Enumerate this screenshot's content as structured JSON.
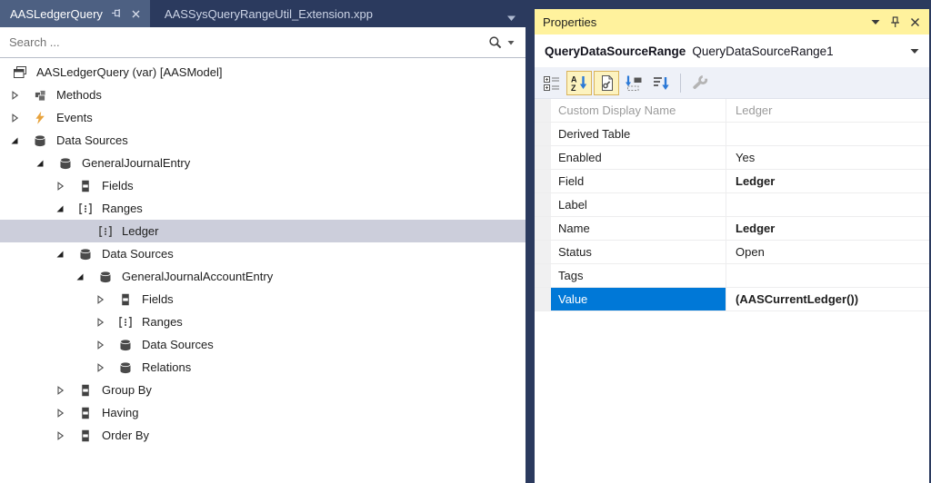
{
  "tabs": {
    "active_label": "AASLedgerQuery",
    "inactive_label": "AASSysQueryRangeUtil_Extension.xpp"
  },
  "search": {
    "placeholder": "Search ..."
  },
  "tree": {
    "items": [
      {
        "label": "AASLedgerQuery (var) [AASModel]",
        "level": 0,
        "expander": "none",
        "icon": "query",
        "selected": false
      },
      {
        "label": "Methods",
        "level": 1,
        "expander": "collapsed",
        "icon": "methods",
        "selected": false
      },
      {
        "label": "Events",
        "level": 1,
        "expander": "collapsed",
        "icon": "events",
        "selected": false
      },
      {
        "label": "Data Sources",
        "level": 1,
        "expander": "expanded",
        "icon": "database",
        "selected": false
      },
      {
        "label": "GeneralJournalEntry",
        "level": 2,
        "expander": "expanded",
        "icon": "database",
        "selected": false
      },
      {
        "label": "Fields",
        "level": 3,
        "expander": "collapsed",
        "icon": "fields",
        "selected": false
      },
      {
        "label": "Ranges",
        "level": 3,
        "expander": "expanded",
        "icon": "ranges",
        "selected": false
      },
      {
        "label": "Ledger",
        "level": 4,
        "expander": "none",
        "icon": "ranges",
        "selected": true
      },
      {
        "label": "Data Sources",
        "level": 3,
        "expander": "expanded",
        "icon": "database",
        "selected": false
      },
      {
        "label": "GeneralJournalAccountEntry",
        "level": 4,
        "expander": "expanded",
        "icon": "database",
        "selected": false
      },
      {
        "label": "Fields",
        "level": 5,
        "expander": "collapsed",
        "icon": "fields",
        "selected": false
      },
      {
        "label": "Ranges",
        "level": 5,
        "expander": "collapsed",
        "icon": "ranges",
        "selected": false
      },
      {
        "label": "Data Sources",
        "level": 5,
        "expander": "collapsed",
        "icon": "database",
        "selected": false
      },
      {
        "label": "Relations",
        "level": 5,
        "expander": "collapsed",
        "icon": "database",
        "selected": false
      },
      {
        "label": "Group By",
        "level": 3,
        "expander": "collapsed",
        "icon": "fields",
        "selected": false
      },
      {
        "label": "Having",
        "level": 3,
        "expander": "collapsed",
        "icon": "fields",
        "selected": false
      },
      {
        "label": "Order By",
        "level": 3,
        "expander": "collapsed",
        "icon": "fields",
        "selected": false
      }
    ]
  },
  "properties": {
    "title": "Properties",
    "object_type": "QueryDataSourceRange",
    "object_instance": "QueryDataSourceRange1",
    "toolbar": [
      {
        "name": "categorized",
        "selected": false,
        "disabled": false
      },
      {
        "name": "alphabetical",
        "selected": true,
        "disabled": false
      },
      {
        "name": "property-pages",
        "selected": true,
        "disabled": false
      },
      {
        "name": "set-value",
        "selected": false,
        "disabled": false
      },
      {
        "name": "sort-descending",
        "selected": false,
        "disabled": false
      },
      {
        "name": "separator"
      },
      {
        "name": "advanced-wrench",
        "selected": false,
        "disabled": true
      }
    ],
    "rows": [
      {
        "label": "Custom Display Name",
        "value": "Ledger",
        "disabled": true,
        "value_bold": false,
        "selected": false
      },
      {
        "label": "Derived Table",
        "value": "",
        "disabled": false,
        "value_bold": false,
        "selected": false
      },
      {
        "label": "Enabled",
        "value": "Yes",
        "disabled": false,
        "value_bold": false,
        "selected": false
      },
      {
        "label": "Field",
        "value": "Ledger",
        "disabled": false,
        "value_bold": true,
        "selected": false
      },
      {
        "label": "Label",
        "value": "",
        "disabled": false,
        "value_bold": false,
        "selected": false
      },
      {
        "label": "Name",
        "value": "Ledger",
        "disabled": false,
        "value_bold": true,
        "selected": false
      },
      {
        "label": "Status",
        "value": "Open",
        "disabled": false,
        "value_bold": false,
        "selected": false
      },
      {
        "label": "Tags",
        "value": "",
        "disabled": false,
        "value_bold": false,
        "selected": false
      },
      {
        "label": "Value",
        "value": "(AASCurrentLedger())",
        "disabled": false,
        "value_bold": true,
        "selected": true
      }
    ]
  },
  "colors": {
    "frame_navy": "#2b3a5e",
    "active_tab": "#4d6082",
    "title_yellow": "#fff29d",
    "selection_blue": "#0078d7",
    "inactive_tree_selection": "#cccedb",
    "toolbar_selected_bg": "#fdf3bf",
    "toolbar_selected_border": "#d9b35b",
    "icon_blue": "#2b79d7",
    "icon_orange": "#e8a33d",
    "icon_gray": "#424242"
  }
}
